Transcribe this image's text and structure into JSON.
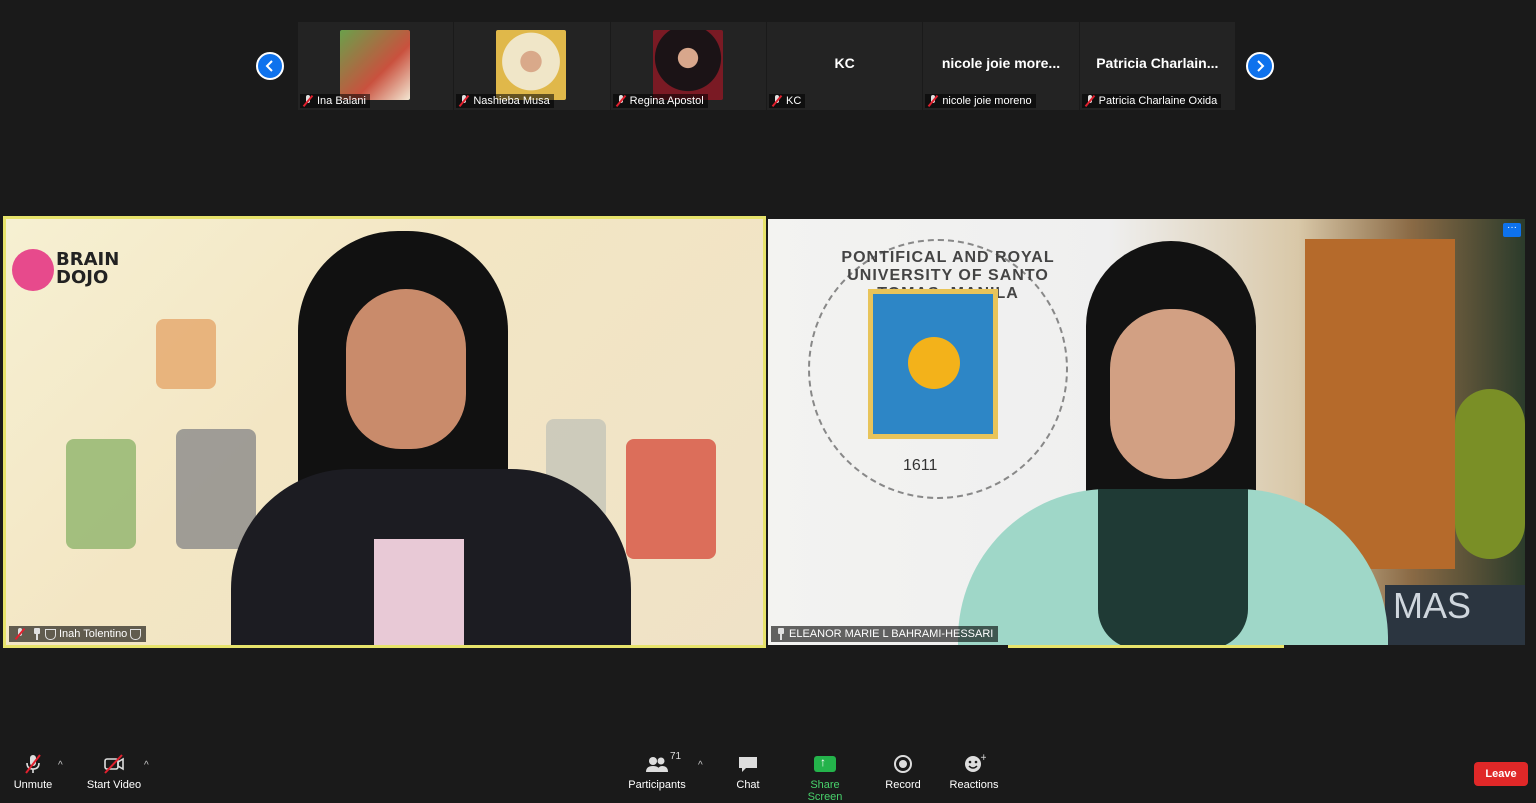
{
  "strip": {
    "participants": [
      {
        "name": "Ina Balani",
        "display": "",
        "has_photo": true,
        "photo_color": "#6aa04b"
      },
      {
        "name": "Nashieba Musa",
        "display": "",
        "has_photo": true,
        "photo_color": "#e8d7b2"
      },
      {
        "name": "Regina Apostol",
        "display": "",
        "has_photo": true,
        "photo_color": "#2a1f24"
      },
      {
        "name": "KC",
        "display": "KC",
        "has_photo": false
      },
      {
        "name": "nicole joie moreno",
        "display": "nicole joie more...",
        "has_photo": false
      },
      {
        "name": "Patricia Charlaine Oxida",
        "display": "Patricia Charlain...",
        "has_photo": false
      }
    ]
  },
  "main_videos": {
    "left": {
      "name": "Inah Tolentino",
      "logo_text_1": "BRAIN",
      "logo_text_2": "DOJO"
    },
    "right": {
      "name": "ELEANOR MARIE L BAHRAMI-HESSARI",
      "more_label": "···",
      "seal_text": "PONTIFICAL AND ROYAL UNIVERSITY OF SANTO TOMAS, MANILA",
      "seal_year": "1611",
      "sign_text": "MAS"
    }
  },
  "toolbar": {
    "unmute": "Unmute",
    "start_video": "Start Video",
    "participants": "Participants",
    "participants_count": "71",
    "chat": "Chat",
    "share_screen": "Share Screen",
    "record": "Record",
    "reactions": "Reactions",
    "leave": "Leave"
  },
  "colors": {
    "accent_blue": "#0e72ed",
    "active_speaker": "#e7e36b",
    "share_green": "#24b34b",
    "leave_red": "#e02828"
  }
}
